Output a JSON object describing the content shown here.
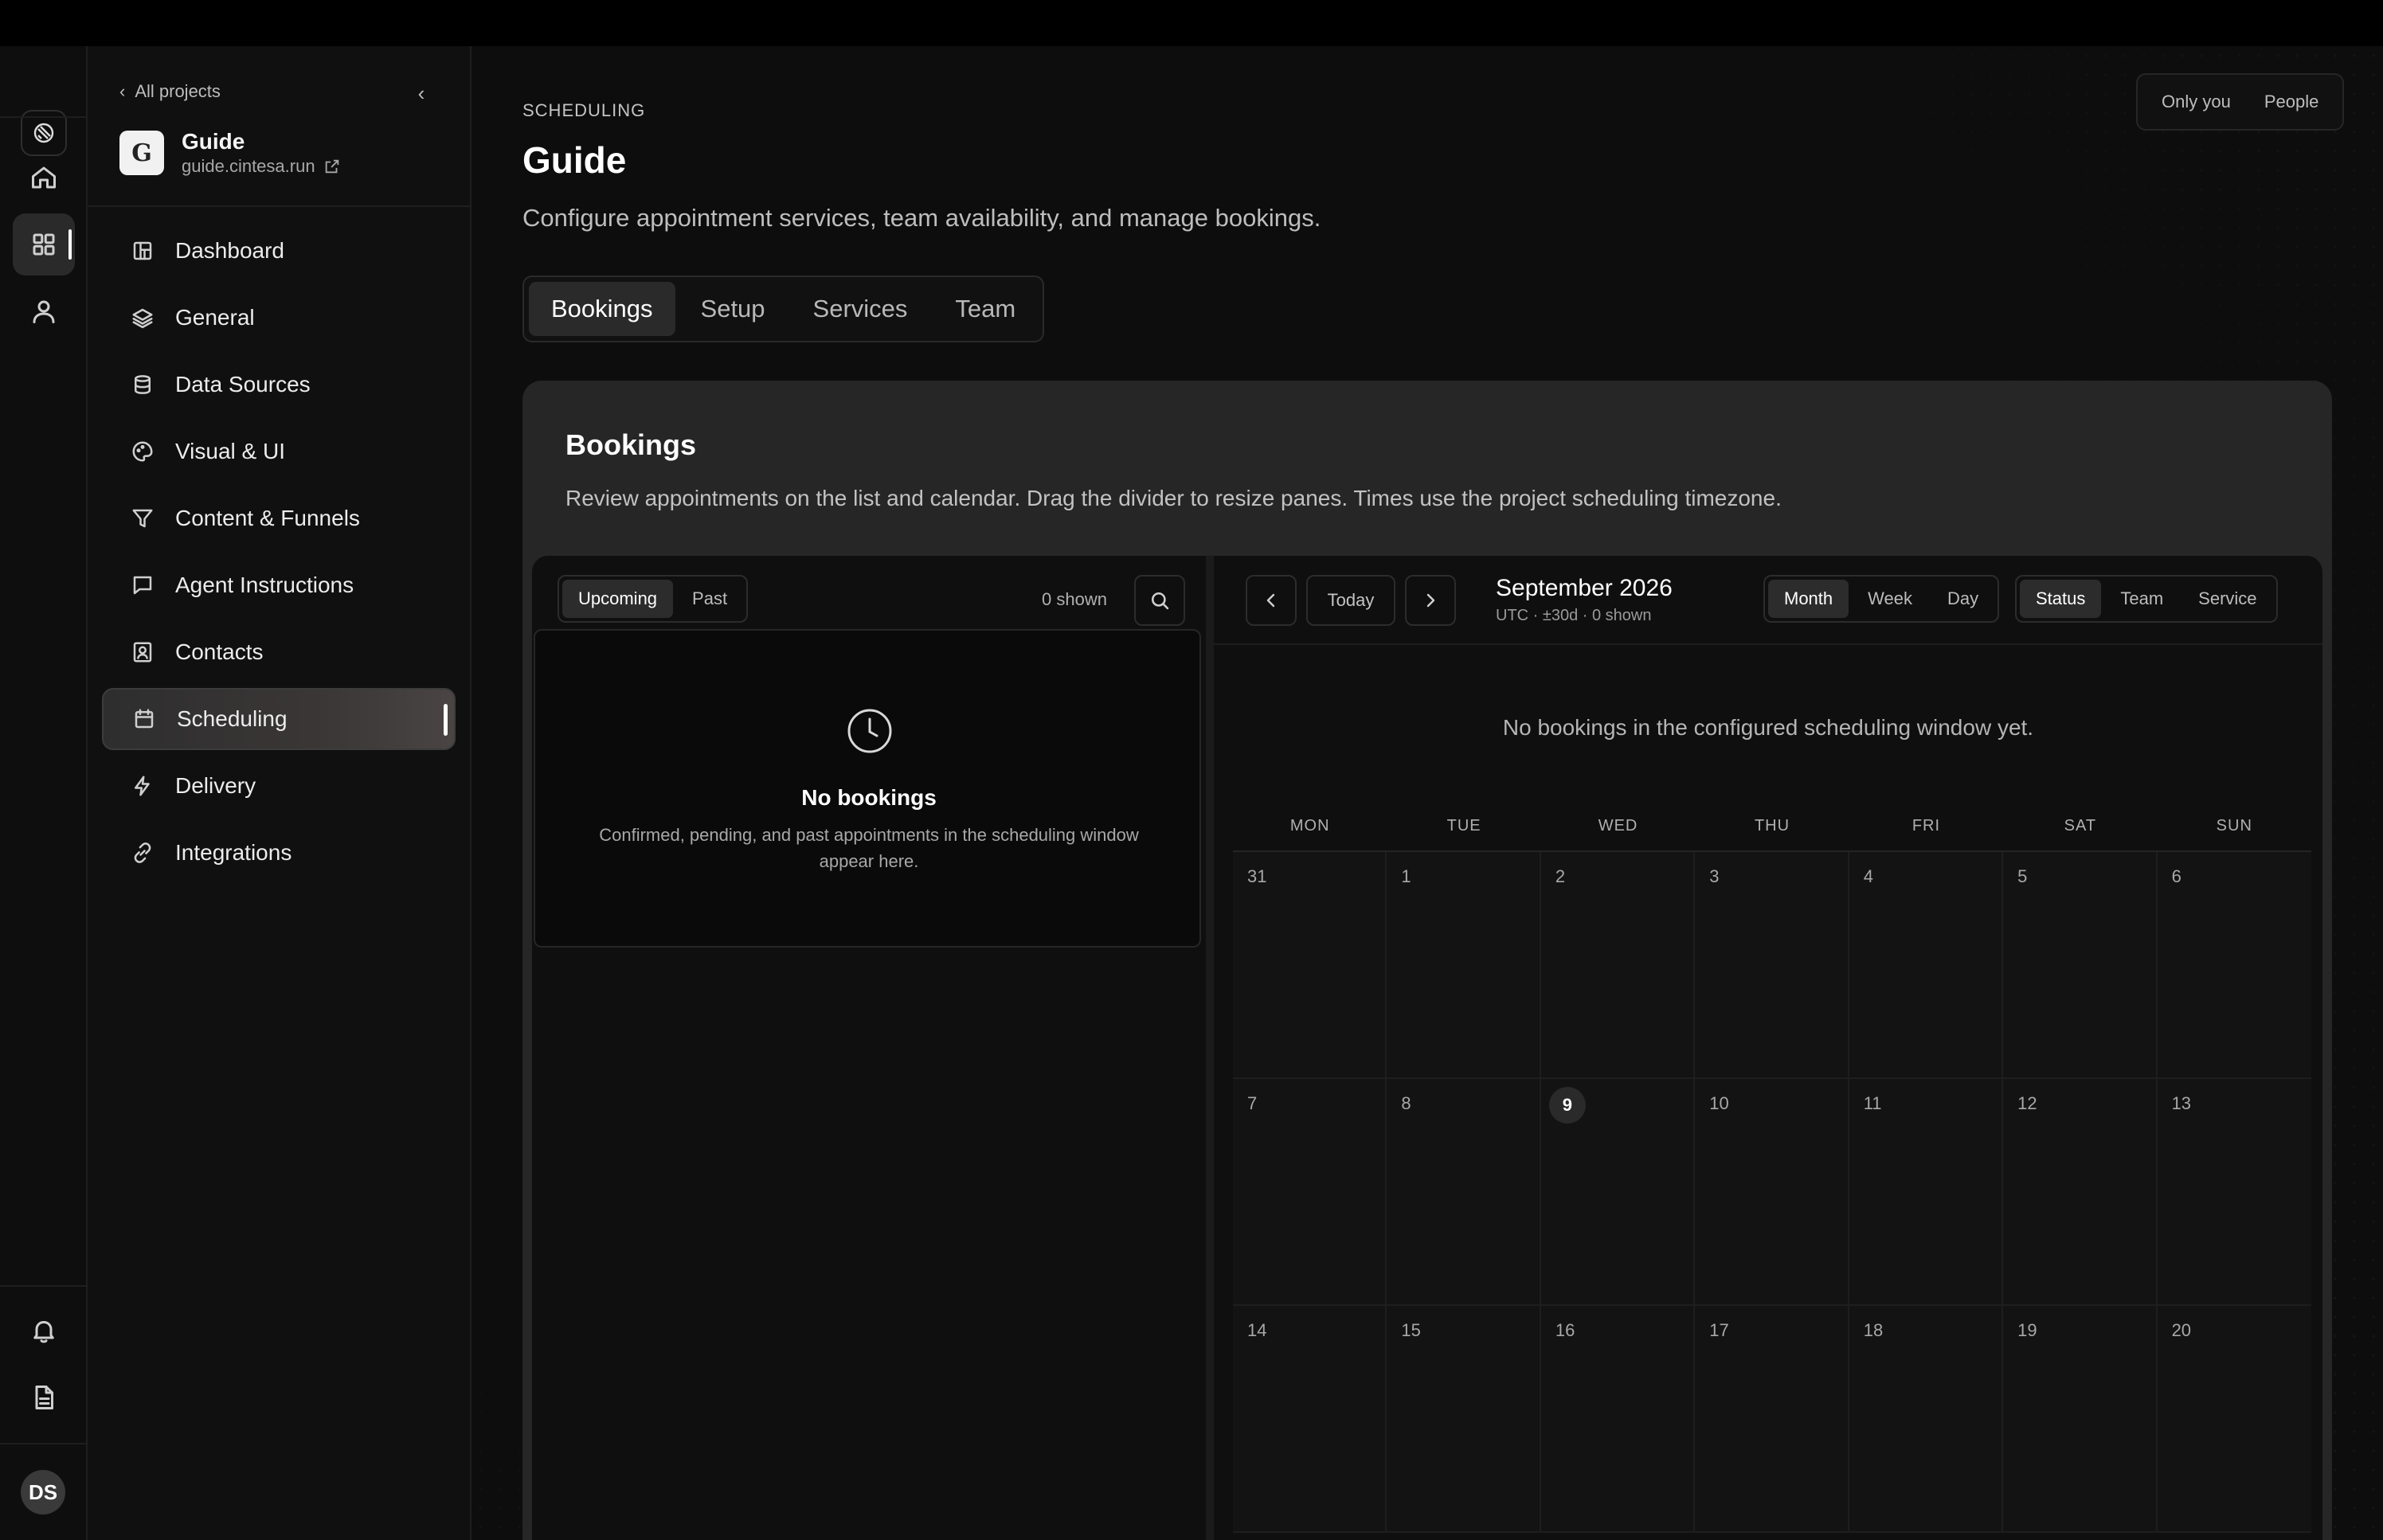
{
  "rail": {
    "top_items": [
      "home-icon",
      "grid-icon",
      "user-icon"
    ],
    "bottom_items": [
      "bell-icon",
      "document-icon"
    ],
    "avatar_initials": "DS"
  },
  "sidebar": {
    "back_label": "All projects",
    "project": {
      "name": "Guide",
      "url": "guide.cintesa.run"
    },
    "items": [
      {
        "label": "Dashboard",
        "icon": "dashboard-icon"
      },
      {
        "label": "General",
        "icon": "layers-icon"
      },
      {
        "label": "Data Sources",
        "icon": "database-icon"
      },
      {
        "label": "Visual & UI",
        "icon": "palette-icon"
      },
      {
        "label": "Content & Funnels",
        "icon": "funnel-icon"
      },
      {
        "label": "Agent Instructions",
        "icon": "message-icon"
      },
      {
        "label": "Contacts",
        "icon": "contact-icon"
      },
      {
        "label": "Scheduling",
        "icon": "calendar-icon",
        "active": true
      },
      {
        "label": "Delivery",
        "icon": "lightning-icon"
      },
      {
        "label": "Integrations",
        "icon": "link-icon"
      }
    ]
  },
  "header": {
    "visibility": [
      "Only you",
      "People"
    ],
    "eyebrow": "SCHEDULING",
    "title": "Guide",
    "description": "Configure appointment services, team availability, and manage bookings."
  },
  "tabs": [
    {
      "label": "Bookings",
      "active": true
    },
    {
      "label": "Setup"
    },
    {
      "label": "Services"
    },
    {
      "label": "Team"
    }
  ],
  "card": {
    "title": "Bookings",
    "description": "Review appointments on the list and calendar. Drag the divider to resize panes. Times use the project scheduling timezone."
  },
  "list_pane": {
    "filters": [
      "Upcoming",
      "Past"
    ],
    "count": "0 shown",
    "empty": {
      "title": "No bookings",
      "description": "Confirmed, pending, and past appointments in the scheduling window appear here."
    }
  },
  "calendar": {
    "today_label": "Today",
    "month": "September 2026",
    "subtitle": "UTC · ±30d · 0 shown",
    "views": [
      "Month",
      "Week",
      "Day"
    ],
    "group_by": [
      "Status",
      "Team",
      "Service"
    ],
    "empty_message": "No bookings in the configured scheduling window yet.",
    "weekdays": [
      "MON",
      "TUE",
      "WED",
      "THU",
      "FRI",
      "SAT",
      "SUN"
    ],
    "days": [
      "31",
      "1",
      "2",
      "3",
      "4",
      "5",
      "6",
      "7",
      "8",
      "9",
      "10",
      "11",
      "12",
      "13",
      "14",
      "15",
      "16",
      "17",
      "18",
      "19",
      "20"
    ],
    "today": "9"
  },
  "colors": {
    "accent": "#ffffff",
    "background": "#0d0d0d",
    "card": "#262626"
  }
}
